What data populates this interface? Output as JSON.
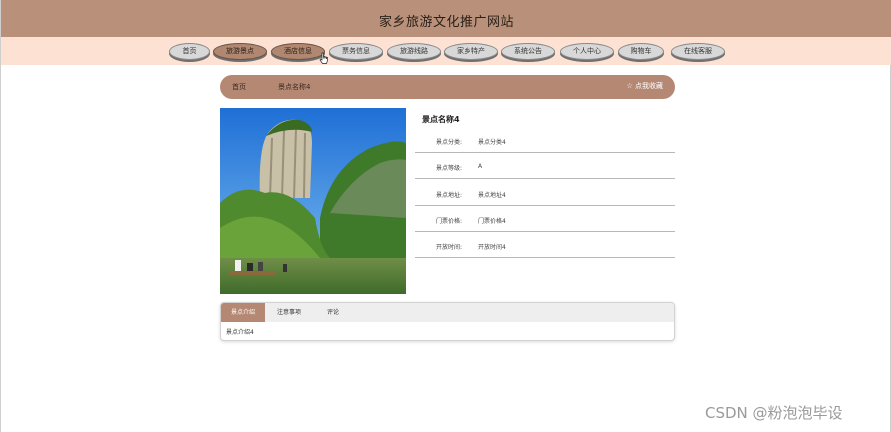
{
  "site": {
    "title": "家乡旅游文化推广网站"
  },
  "nav": {
    "items": [
      {
        "label": "首页",
        "active": false
      },
      {
        "label": "旅游景点",
        "active": true
      },
      {
        "label": "酒店信息",
        "active": true
      },
      {
        "label": "票务信息",
        "active": false
      },
      {
        "label": "旅游线路",
        "active": false
      },
      {
        "label": "家乡特产",
        "active": false
      },
      {
        "label": "系统公告",
        "active": false
      },
      {
        "label": "个人中心",
        "active": false
      },
      {
        "label": "购物车",
        "active": false
      },
      {
        "label": "在线客服",
        "active": false
      }
    ]
  },
  "breadcrumb": {
    "home": "首页",
    "current": "景点名称4",
    "favorite": "☆ 点我收藏"
  },
  "detail": {
    "title": "景点名称4",
    "attributes": [
      {
        "label": "景点分类:",
        "value": "景点分类4"
      },
      {
        "label": "景点等级:",
        "value": "A"
      },
      {
        "label": "景点地址:",
        "value": "景点地址4"
      },
      {
        "label": "门票价格:",
        "value": "门票价格4"
      },
      {
        "label": "开放时间:",
        "value": "开放时间4"
      }
    ]
  },
  "tabs": {
    "items": [
      {
        "label": "景点介绍",
        "active": true
      },
      {
        "label": "注意事项",
        "active": false
      },
      {
        "label": "评论",
        "active": false
      }
    ],
    "content": "景点介绍4"
  },
  "watermark": "CSDN @粉泡泡毕设",
  "colors": {
    "header": "#b9907a",
    "nav_bg": "#fde1d3",
    "accent": "#b58874"
  }
}
